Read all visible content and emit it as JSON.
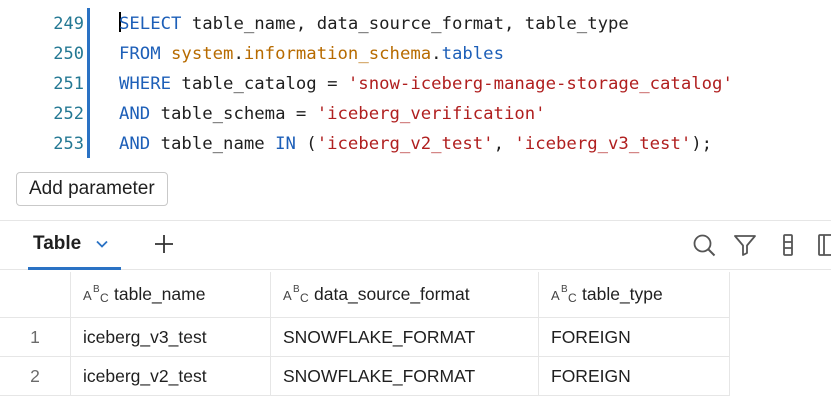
{
  "editor": {
    "line_numbers": [
      "249",
      "250",
      "251",
      "252",
      "253"
    ],
    "lines": [
      [
        {
          "t": "SELECT",
          "c": "kw"
        },
        {
          "t": " table_name, data_source_format, table_type",
          "c": ""
        }
      ],
      [
        {
          "t": "FROM",
          "c": "kw"
        },
        {
          "t": " ",
          "c": ""
        },
        {
          "t": "system",
          "c": "id"
        },
        {
          "t": ".",
          "c": ""
        },
        {
          "t": "information_schema",
          "c": "id"
        },
        {
          "t": ".",
          "c": ""
        },
        {
          "t": "tables",
          "c": "kw"
        }
      ],
      [
        {
          "t": "WHERE",
          "c": "kw"
        },
        {
          "t": " table_catalog = ",
          "c": ""
        },
        {
          "t": "'snow-iceberg-manage-storage_catalog'",
          "c": "str"
        }
      ],
      [
        {
          "t": "AND",
          "c": "kw"
        },
        {
          "t": " table_schema = ",
          "c": ""
        },
        {
          "t": "'iceberg_verification'",
          "c": "str"
        }
      ],
      [
        {
          "t": "AND",
          "c": "kw"
        },
        {
          "t": " table_name ",
          "c": ""
        },
        {
          "t": "IN",
          "c": "kw"
        },
        {
          "t": " (",
          "c": ""
        },
        {
          "t": "'iceberg_v2_test'",
          "c": "str"
        },
        {
          "t": ", ",
          "c": ""
        },
        {
          "t": "'iceberg_v3_test'",
          "c": "str"
        },
        {
          "t": ");",
          "c": ""
        }
      ]
    ]
  },
  "add_parameter_label": "Add parameter",
  "results": {
    "tab_label": "Table",
    "tools": [
      "search-icon",
      "filter-icon",
      "columns-icon",
      "panel-icon"
    ]
  },
  "table": {
    "columns": [
      "table_name",
      "data_source_format",
      "table_type"
    ],
    "rows": [
      {
        "num": "1",
        "cells": [
          "iceberg_v3_test",
          "SNOWFLAKE_FORMAT",
          "FOREIGN"
        ]
      },
      {
        "num": "2",
        "cells": [
          "iceberg_v2_test",
          "SNOWFLAKE_FORMAT",
          "FOREIGN"
        ]
      }
    ]
  },
  "colors": {
    "keyword": "#1d5fb8",
    "identifier": "#b76b00",
    "string": "#b01f1f",
    "accent": "#2a72c4"
  }
}
